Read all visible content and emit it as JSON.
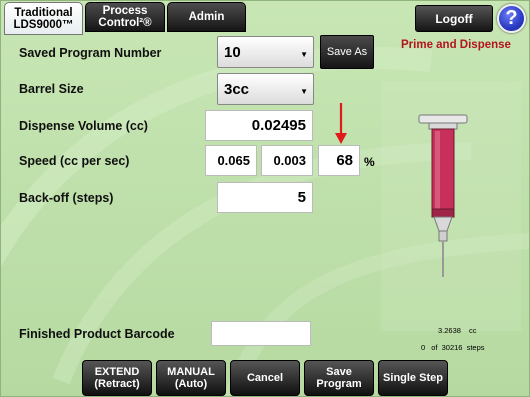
{
  "tabs": [
    {
      "line1": "Traditional",
      "line2": "LDS9000™",
      "active": true
    },
    {
      "line1": "Process",
      "line2": "Control²®",
      "active": false
    },
    {
      "line1": "Admin",
      "line2": "",
      "active": false
    }
  ],
  "header": {
    "logoff_label": "Logoff",
    "help_label": "?",
    "mode_title": "Prime and Dispense"
  },
  "form": {
    "saved_program_label": "Saved Program Number",
    "saved_program_value": "10",
    "save_as_label": "Save As",
    "barrel_size_label": "Barrel Size",
    "barrel_size_value": "3cc",
    "dispense_volume_label": "Dispense Volume (cc)",
    "dispense_volume_value": "0.02495",
    "speed_label": "Speed (cc per sec)",
    "speed_value_1": "0.065",
    "speed_value_2": "0.003",
    "speed_percent": "68",
    "percent_sign": "%",
    "backoff_label": "Back-off (steps)",
    "backoff_value": "5",
    "barcode_label": "Finished Product Barcode",
    "barcode_value": ""
  },
  "status": {
    "volume_value": "3.2638",
    "volume_unit": "cc",
    "steps_current": "0",
    "steps_of": "of",
    "steps_total": "30216",
    "steps_unit": "steps"
  },
  "bottom_buttons": [
    {
      "line1": "EXTEND",
      "line2": "(Retract)"
    },
    {
      "line1": "MANUAL",
      "line2": "(Auto)"
    },
    {
      "line1": "Cancel",
      "line2": ""
    },
    {
      "line1": "Save",
      "line2": "Program"
    },
    {
      "line1": "Single Step",
      "line2": ""
    }
  ],
  "colors": {
    "accent_red": "#b3131e",
    "background_green": "#c7e6b4",
    "syringe_barrel": "#c7305a"
  },
  "icons": {
    "help": "question-mark-icon",
    "dropdown": "chevron-down-icon",
    "pointer": "red-down-arrow-icon",
    "syringe": "syringe-icon"
  }
}
